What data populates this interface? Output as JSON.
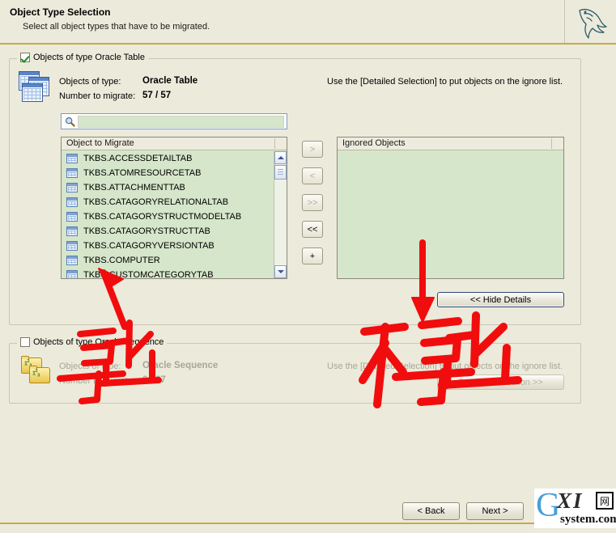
{
  "header": {
    "title": "Object Type Selection",
    "subtitle": "Select all object types that have to be migrated.",
    "logo_icon": "mysql-dolphin-icon"
  },
  "table_section": {
    "legend": "Objects of type Oracle Table",
    "checked": true,
    "icon": "oracle-table-stack-icon",
    "type_label": "Objects of type:",
    "type_value": "Oracle Table",
    "count_label": "Number to migrate:",
    "count_value": "57 / 57",
    "hint": "Use the [Detailed Selection] to put objects on the ignore list.",
    "search": {
      "icon": "search-magnifier-icon",
      "value": "",
      "placeholder": ""
    },
    "migrate_list": {
      "header": "Object to Migrate",
      "items": [
        "TKBS.ACCESSDETAILTAB",
        "TKBS.ATOMRESOURCETAB",
        "TKBS.ATTACHMENTTAB",
        "TKBS.CATAGORYRELATIONALTAB",
        "TKBS.CATAGORYSTRUCTMODELTAB",
        "TKBS.CATAGORYSTRUCTTAB",
        "TKBS.CATAGORYVERSIONTAB",
        "TKBS.COMPUTER",
        "TKBS.CUSTOMCATEGORYTAB"
      ]
    },
    "ignored_list": {
      "header": "Ignored Objects",
      "items": []
    },
    "transfer_buttons": [
      {
        "label": ">",
        "name": "move-right-button",
        "disabled": true
      },
      {
        "label": "<",
        "name": "move-left-button",
        "disabled": true
      },
      {
        "label": ">>",
        "name": "move-all-right-button",
        "disabled": true
      },
      {
        "label": "<<",
        "name": "move-all-left-button",
        "disabled": false
      },
      {
        "label": "+",
        "name": "add-object-button",
        "disabled": false
      }
    ],
    "hide_details_label": "<< Hide Details"
  },
  "sequence_section": {
    "legend": "Objects of type Oracle Sequence",
    "checked": false,
    "icon": "oracle-sequence-folder-icon",
    "type_label": "Objects of type:",
    "type_value": "Oracle Sequence",
    "count_label": "Number to migrate:",
    "count_value": "0 / 97",
    "hint": "Use the [Detailed Selection] to put objects on the ignore list.",
    "detailed_selection_label": "Detailed Selection >>"
  },
  "footer": {
    "back_label": "< Back",
    "next_label": "Next >"
  },
  "watermark": {
    "g": "G",
    "xi": "XI",
    "box": "网",
    "system": "system.com"
  },
  "annotations": {
    "color": "#F10D0D",
    "marks": [
      {
        "name": "export-annotation",
        "text": "导出",
        "note": "handwritten red, points at Object to Migrate list"
      },
      {
        "name": "no-export-annotation",
        "text": "不导出",
        "note": "handwritten red, points at Ignored Objects list"
      }
    ]
  }
}
